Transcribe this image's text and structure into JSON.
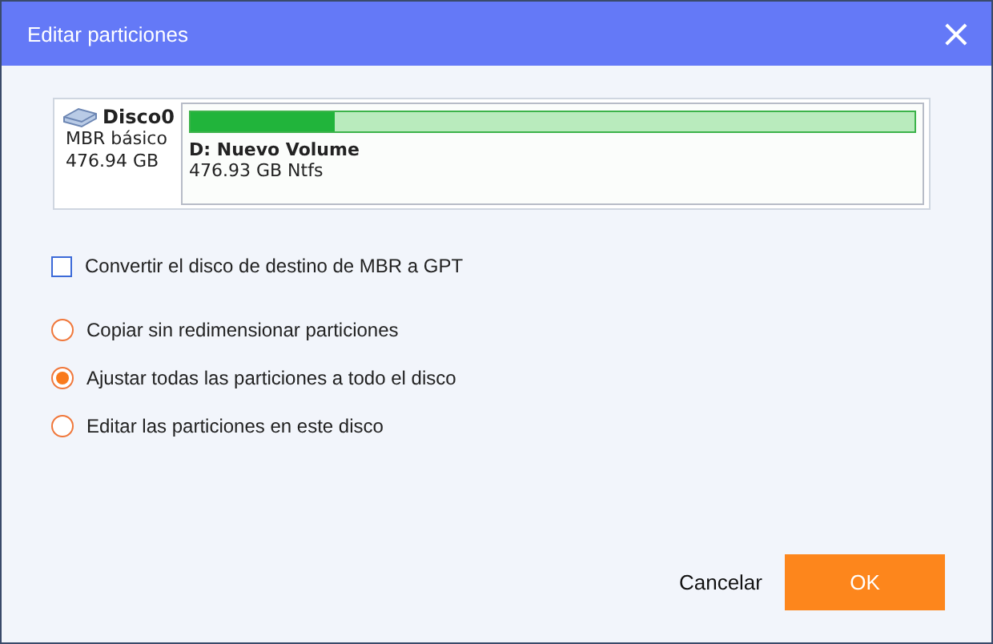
{
  "window": {
    "title": "Editar particiones",
    "close": "×"
  },
  "disk": {
    "name": "Disco0",
    "type": "MBR básico",
    "size": "476.94 GB",
    "partition": {
      "label": "D: Nuevo Volume",
      "info": "476.93 GB Ntfs",
      "level": 0.2
    }
  },
  "convert": {
    "label": "Convertir el disco de destino de MBR a GPT",
    "checked": false
  },
  "options": [
    {
      "label": "Copiar sin redimensionar particiones",
      "selected": false
    },
    {
      "label": "Ajustar todas las particiones a todo el disco",
      "selected": true
    },
    {
      "label": "Editar las particiones en este disco",
      "selected": false
    }
  ],
  "buttons": {
    "cancel": "Cancelar",
    "ok": "OK"
  }
}
